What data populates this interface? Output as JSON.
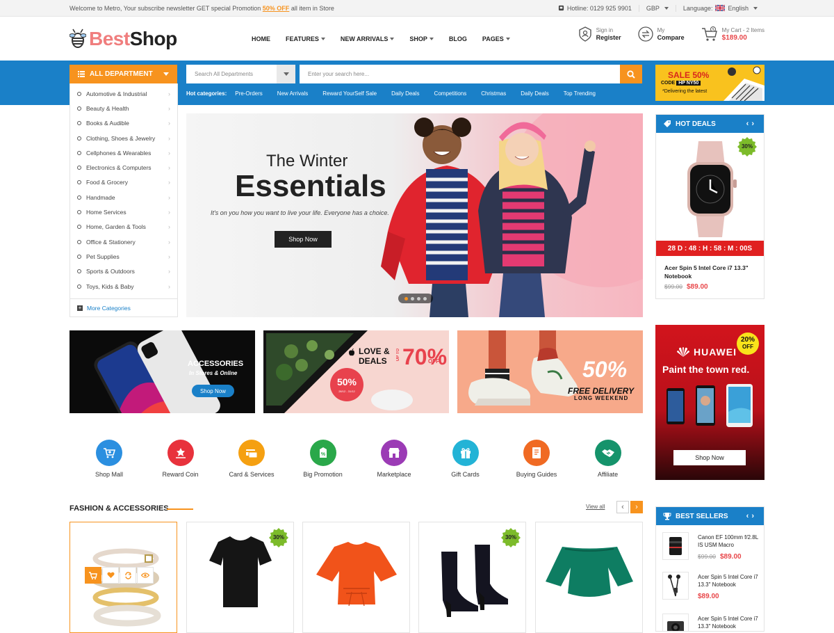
{
  "topbar": {
    "welcome": "Welcome to Metro, Your subscribe newsletter GET special Promotion ",
    "promo_highlight": "50% OFF",
    "welcome_end": " all item in Store",
    "hotline": "Hotline: 0129 925 9901",
    "currency": "GBP",
    "language_label": "Language:",
    "language": "English"
  },
  "header": {
    "logo_part1": "Best",
    "logo_part2": "Shop",
    "nav": [
      "HOME",
      "FEATURES",
      "NEW ARRIVALS",
      "SHOP",
      "BLOG",
      "PAGES"
    ],
    "signin_small": "Sign in",
    "signin_big": "Register",
    "compare_small": "My",
    "compare_big": "Compare",
    "cart_small": "My Cart - 2 Items",
    "cart_price": "$189.00"
  },
  "search": {
    "all_department": "ALL DEPARTMENT",
    "category_placeholder": "Search All Departments",
    "input_placeholder": "Enter your search here...",
    "hot_label": "Hot categories:",
    "hot_categories": [
      "Pre-Orders",
      "New Arrivals",
      "Reward YourSelf Sale",
      "Daily Deals",
      "Competitions",
      "Christmas",
      "Daily Deals",
      "Top Trending"
    ]
  },
  "sale_banner": {
    "title": "SALE 50%",
    "code_label": "CODE",
    "code": "HP NY50",
    "sub": "*Delivering the latest"
  },
  "departments": [
    "Automotive & Industrial",
    "Beauty & Health",
    "Books & Audible",
    "Clothing, Shoes & Jewelry",
    "Cellphones & Wearables",
    "Electronics & Computers",
    "Food & Grocery",
    "Handmade",
    "Home Services",
    "Home, Garden & Tools",
    "Office & Stationery",
    "Pet Supplies",
    "Sports & Outdoors",
    "Toys, Kids & Baby"
  ],
  "more_categories": "More Categories",
  "hero": {
    "line1": "The Winter",
    "line2": "Essentials",
    "tagline": "It's on you how you want to live your life. Everyone has a choice.",
    "button": "Shop Now"
  },
  "hot_deals": {
    "title": "HOT DEALS",
    "badge": "30%",
    "timer": "28 D : 48 : H : 58 : M : 00S",
    "product": "Acer Spin 5 Intel Core i7 13.3\" Notebook",
    "old_price": "$99.00",
    "new_price": "$89.00"
  },
  "promos": {
    "p1_title": "ACCESSORIES",
    "p1_sub": "In Stores & Online",
    "p1_button": "Shop Now",
    "p2_title1": "LOVE &",
    "p2_title2": "DEALS",
    "p2_upto": "UP TO",
    "p2_pct": "70%",
    "p2_off": "OFF",
    "p2_badge": "50%",
    "p2_badge_date": "28/12 - 31/12",
    "p3_pct": "50%",
    "p3_title": "FREE DELIVERY",
    "p3_sub": "LONG WEEKEND"
  },
  "huawei": {
    "brand": "HUAWEI",
    "slogan": "Paint the town red.",
    "badge_pct": "20%",
    "badge_off": "OFF",
    "button": "Shop Now"
  },
  "categories": [
    {
      "label": "Shop Mall",
      "color": "#2b8fe0",
      "icon": "cart-icon"
    },
    {
      "label": "Reward Coin",
      "color": "#e8323c",
      "icon": "reward-icon"
    },
    {
      "label": "Card & Services",
      "color": "#f5a011",
      "icon": "card-icon"
    },
    {
      "label": "Big Promotion",
      "color": "#2aa84a",
      "icon": "promotion-icon"
    },
    {
      "label": "Marketplace",
      "color": "#9b3bb5",
      "icon": "store-icon"
    },
    {
      "label": "Gift Cards",
      "color": "#23b3d6",
      "icon": "gift-icon"
    },
    {
      "label": "Buying Guides",
      "color": "#f06a23",
      "icon": "guide-icon"
    },
    {
      "label": "Affiliate",
      "color": "#15936b",
      "icon": "handshake-icon"
    }
  ],
  "fashion": {
    "title": "FASHION & ACCESSORIES",
    "view_all": "View all",
    "badges": [
      "30%",
      "30%"
    ]
  },
  "best_sellers": {
    "title": "BEST SELLERS",
    "items": [
      {
        "name": "Canon EF 100mm f/2.8L IS USM Macro",
        "old": "$99.00",
        "new": "$89.00"
      },
      {
        "name": "Acer Spin 5 Intel Core i7 13.3\" Notebook",
        "old": "",
        "new": "$89.00"
      },
      {
        "name": "Acer Spin 5 Intel Core i7 13.3\" Notebook",
        "old": "",
        "new": ""
      }
    ]
  },
  "colors": {
    "primary_blue": "#1a80c8",
    "accent_orange": "#f7931e",
    "price_red": "#e8474a"
  }
}
